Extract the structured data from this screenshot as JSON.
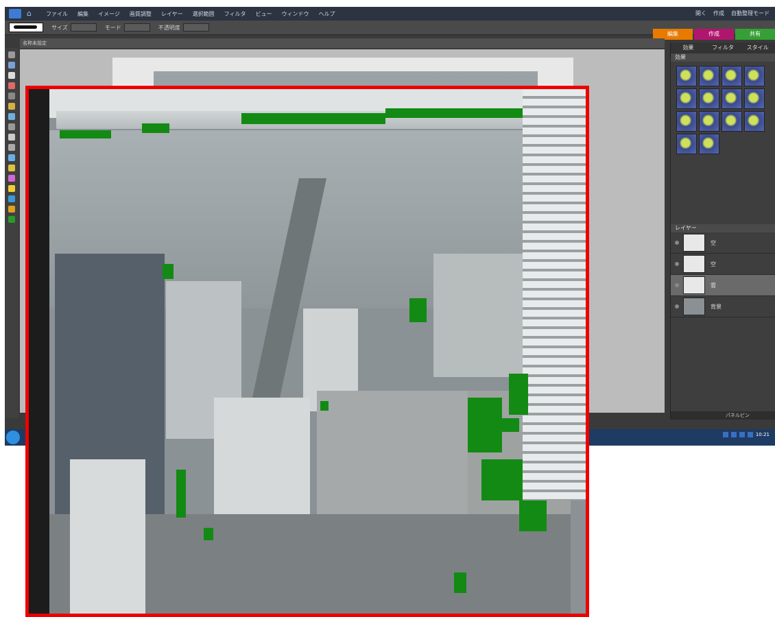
{
  "menubar": {
    "items": [
      "ファイル",
      "編集",
      "イメージ",
      "画質調整",
      "レイヤー",
      "選択範囲",
      "フィルタ",
      "ビュー",
      "ウィンドウ",
      "ヘルプ"
    ],
    "right_items": [
      "開く",
      "作成",
      "自動整理モード"
    ]
  },
  "options": {
    "labels": [
      "サイズ",
      "モード",
      "不透明度"
    ]
  },
  "mode_tabs": [
    {
      "label": "編集",
      "color": "#e87a00"
    },
    {
      "label": "作成",
      "color": "#b0166e"
    },
    {
      "label": "共有",
      "color": "#35a035"
    }
  ],
  "doc_tab": {
    "title": "名称未設定"
  },
  "panel": {
    "tabs": [
      "効果",
      "フィルタ",
      "スタイル"
    ],
    "effects_header": "効果",
    "layers_header": "レイヤー",
    "layers": [
      {
        "name": "空"
      },
      {
        "name": "空"
      },
      {
        "name": "雲"
      },
      {
        "name": "背景"
      }
    ],
    "footer": "パネルビン"
  },
  "taskbar": {
    "time": "10:21"
  },
  "colors": {
    "frame_red": "#ee0000",
    "mask_green": "#138a13",
    "edit_orange": "#e87a00"
  }
}
